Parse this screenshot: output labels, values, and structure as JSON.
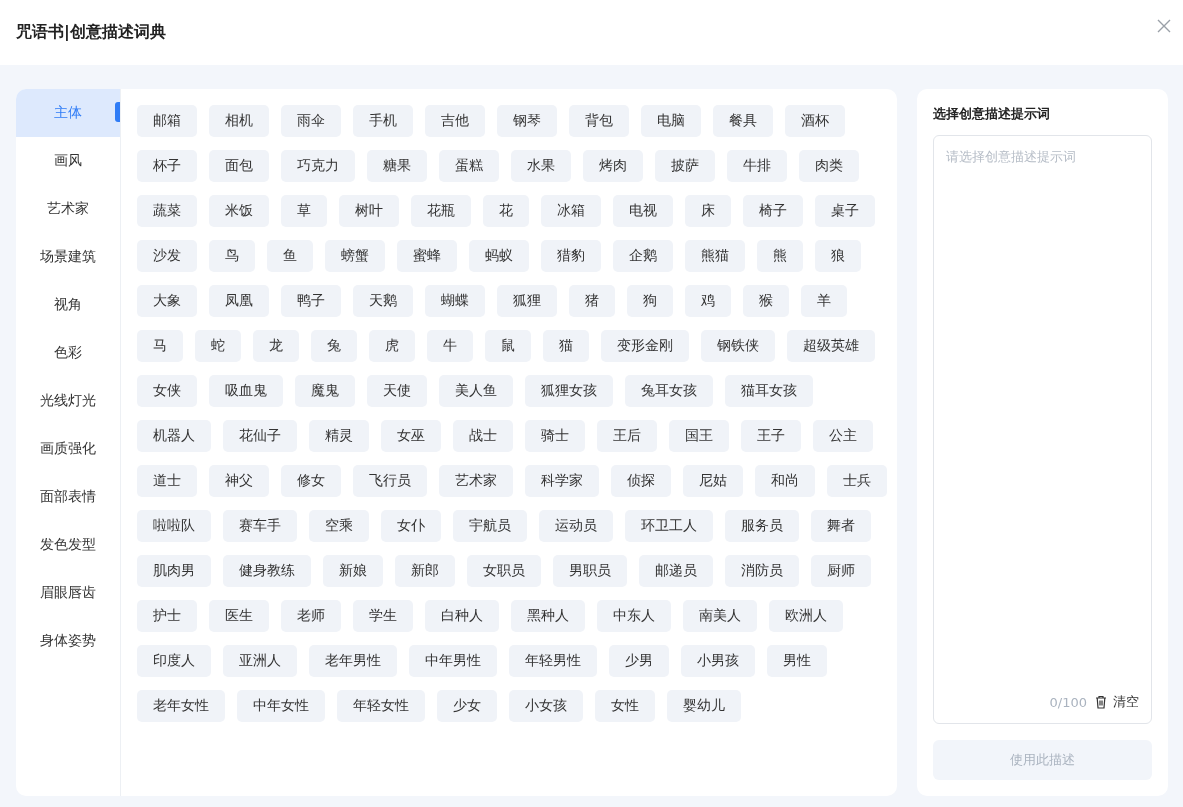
{
  "dialog": {
    "title": "咒语书|创意描述词典"
  },
  "categories": [
    {
      "label": "主体",
      "selected": true
    },
    {
      "label": "画风",
      "selected": false
    },
    {
      "label": "艺术家",
      "selected": false
    },
    {
      "label": "场景建筑",
      "selected": false
    },
    {
      "label": "视角",
      "selected": false
    },
    {
      "label": "色彩",
      "selected": false
    },
    {
      "label": "光线灯光",
      "selected": false
    },
    {
      "label": "画质强化",
      "selected": false
    },
    {
      "label": "面部表情",
      "selected": false
    },
    {
      "label": "发色发型",
      "selected": false
    },
    {
      "label": "眉眼唇齿",
      "selected": false
    },
    {
      "label": "身体姿势",
      "selected": false
    }
  ],
  "tags": [
    "邮箱",
    "相机",
    "雨伞",
    "手机",
    "吉他",
    "钢琴",
    "背包",
    "电脑",
    "餐具",
    "酒杯",
    "杯子",
    "面包",
    "巧克力",
    "糖果",
    "蛋糕",
    "水果",
    "烤肉",
    "披萨",
    "牛排",
    "肉类",
    "蔬菜",
    "米饭",
    "草",
    "树叶",
    "花瓶",
    "花",
    "冰箱",
    "电视",
    "床",
    "椅子",
    "桌子",
    "沙发",
    "鸟",
    "鱼",
    "螃蟹",
    "蜜蜂",
    "蚂蚁",
    "猎豹",
    "企鹅",
    "熊猫",
    "熊",
    "狼",
    "大象",
    "凤凰",
    "鸭子",
    "天鹅",
    "蝴蝶",
    "狐狸",
    "猪",
    "狗",
    "鸡",
    "猴",
    "羊",
    "马",
    "蛇",
    "龙",
    "兔",
    "虎",
    "牛",
    "鼠",
    "猫",
    "变形金刚",
    "钢铁侠",
    "超级英雄",
    "女侠",
    "吸血鬼",
    "魔鬼",
    "天使",
    "美人鱼",
    "狐狸女孩",
    "兔耳女孩",
    "猫耳女孩",
    "机器人",
    "花仙子",
    "精灵",
    "女巫",
    "战士",
    "骑士",
    "王后",
    "国王",
    "王子",
    "公主",
    "道士",
    "神父",
    "修女",
    "飞行员",
    "艺术家",
    "科学家",
    "侦探",
    "尼姑",
    "和尚",
    "士兵",
    "啦啦队",
    "赛车手",
    "空乘",
    "女仆",
    "宇航员",
    "运动员",
    "环卫工人",
    "服务员",
    "舞者",
    "肌肉男",
    "健身教练",
    "新娘",
    "新郎",
    "女职员",
    "男职员",
    "邮递员",
    "消防员",
    "厨师",
    "护士",
    "医生",
    "老师",
    "学生",
    "白种人",
    "黑种人",
    "中东人",
    "南美人",
    "欧洲人",
    "印度人",
    "亚洲人",
    "老年男性",
    "中年男性",
    "年轻男性",
    "少男",
    "小男孩",
    "男性",
    "老年女性",
    "中年女性",
    "年轻女性",
    "少女",
    "小女孩",
    "女性",
    "婴幼儿"
  ],
  "prompt_panel": {
    "title": "选择创意描述提示词",
    "placeholder": "请选择创意描述提示词",
    "count": "0/100",
    "clear_label": "清空",
    "submit": {
      "label": "使用此描述",
      "disabled": true
    }
  }
}
